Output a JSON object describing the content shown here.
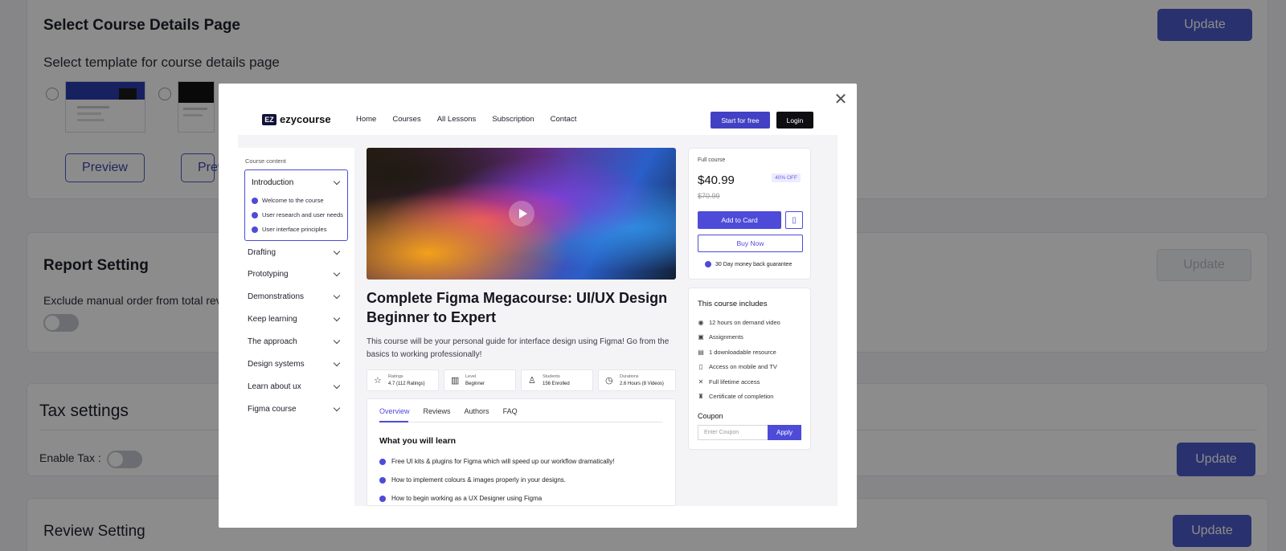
{
  "course_details": {
    "title": "Select Course Details Page",
    "subtitle": "Select template for course details page",
    "update_label": "Update",
    "preview_label_1": "Preview",
    "preview_label_2": "Prev"
  },
  "report": {
    "title": "Report Setting",
    "desc": "Exclude manual order from total rev",
    "update_label": "Update"
  },
  "tax": {
    "title": "Tax settings",
    "enable_label": "Enable Tax :",
    "update_label": "Update"
  },
  "review": {
    "title": "Review Setting",
    "update_label": "Update"
  },
  "modal": {
    "close_glyph": "✕",
    "preview": {
      "logo_mark": "EZ",
      "logo_text": "ezycourse",
      "nav": [
        "Home",
        "Courses",
        "All Lessons",
        "Subscription",
        "Contact"
      ],
      "start_label": "Start for free",
      "login_label": "Login",
      "sidebar": {
        "heading": "Course content",
        "open_section": "Introduction",
        "open_items": [
          "Welcome to the course",
          "User research and user needs",
          "User interface principles"
        ],
        "sections": [
          "Drafting",
          "Prototyping",
          "Demonstrations",
          "Keep learning",
          "The approach",
          "Design systems",
          "Learn about ux",
          "Figma course"
        ]
      },
      "course_title": "Complete Figma Megacourse: UI/UX Design Beginner to Expert",
      "course_desc": "This course will be your personal guide for interface design using Figma! Go from the basics to working professionally!",
      "stats": [
        {
          "icon": "☆",
          "label": "Ratings",
          "value": "4.7 (112 Ratings)"
        },
        {
          "icon": "▥",
          "label": "Level",
          "value": "Beginner"
        },
        {
          "icon": "♙",
          "label": "Students",
          "value": "156 Enrolled"
        },
        {
          "icon": "◷",
          "label": "Durations",
          "value": "2.6 Hours (8 Videos)"
        }
      ],
      "tabs": [
        "Overview",
        "Reviews",
        "Authors",
        "FAQ"
      ],
      "learn_title": "What you will learn",
      "learn_items": [
        "Free UI kits & plugins for Figma which will speed up our workflow dramatically!",
        "How to implement colours & images properly in your designs.",
        "How to begin working as a UX Designer using Figma"
      ],
      "pricing": {
        "label": "Full course",
        "price": "$40.99",
        "discount": "40% OFF",
        "old_price": "$70.99",
        "add_label": "Add to Card",
        "buy_label": "Buy Now",
        "guarantee": "30 Day money back guarantee"
      },
      "includes": {
        "title": "This course includes",
        "items": [
          {
            "icon": "◉",
            "text": "12 hours on demand video"
          },
          {
            "icon": "▣",
            "text": "Assignments"
          },
          {
            "icon": "▤",
            "text": "1 downloadable resource"
          },
          {
            "icon": "▯",
            "text": "Access on mobile and TV"
          },
          {
            "icon": "✕",
            "text": "Full lifetime access"
          },
          {
            "icon": "♜",
            "text": "Certificate of completion"
          }
        ],
        "coupon_label": "Coupon",
        "coupon_placeholder": "Enter Coupon",
        "apply_label": "Apply"
      }
    }
  },
  "colors": {
    "accent": "#4b5ac9",
    "preview_accent": "#4d4bd8"
  }
}
